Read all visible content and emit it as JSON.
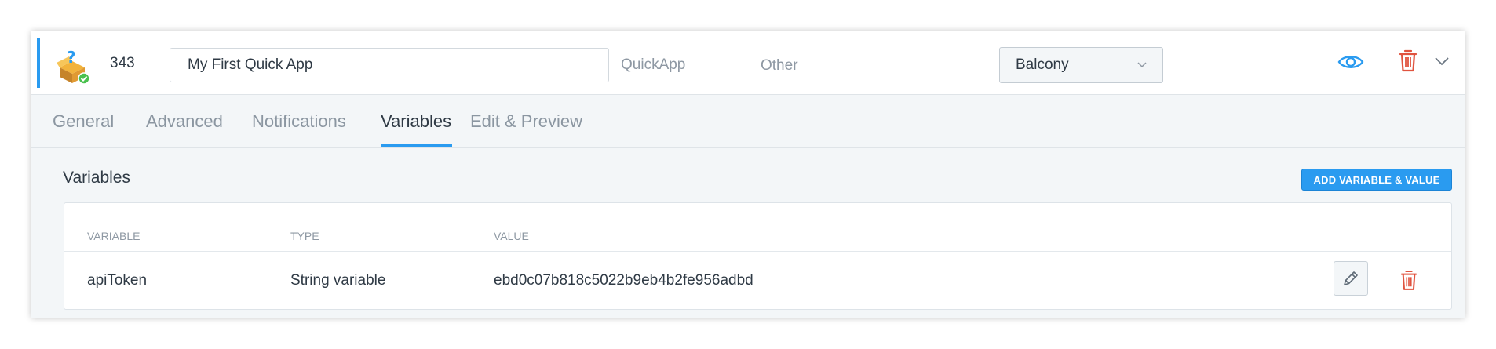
{
  "device": {
    "id": "343",
    "name": "My First Quick App",
    "type": "QuickApp",
    "category": "Other",
    "room": "Balcony",
    "icon": "quickapp-box-icon"
  },
  "tabs": [
    {
      "label": "General"
    },
    {
      "label": "Advanced"
    },
    {
      "label": "Notifications"
    },
    {
      "label": "Variables",
      "active": true
    },
    {
      "label": "Edit & Preview"
    }
  ],
  "variables_section": {
    "title": "Variables",
    "add_button_label": "ADD VARIABLE & VALUE",
    "columns": [
      "VARIABLE",
      "TYPE",
      "VALUE"
    ],
    "rows": [
      {
        "variable": "apiToken",
        "type": "String variable",
        "value": "ebd0c07b818c5022b9eb4b2fe956adbd"
      }
    ]
  },
  "colors": {
    "accent": "#2a9bf0",
    "danger": "#e0533f",
    "text": "#2f3a45",
    "muted": "#8e98a3"
  }
}
